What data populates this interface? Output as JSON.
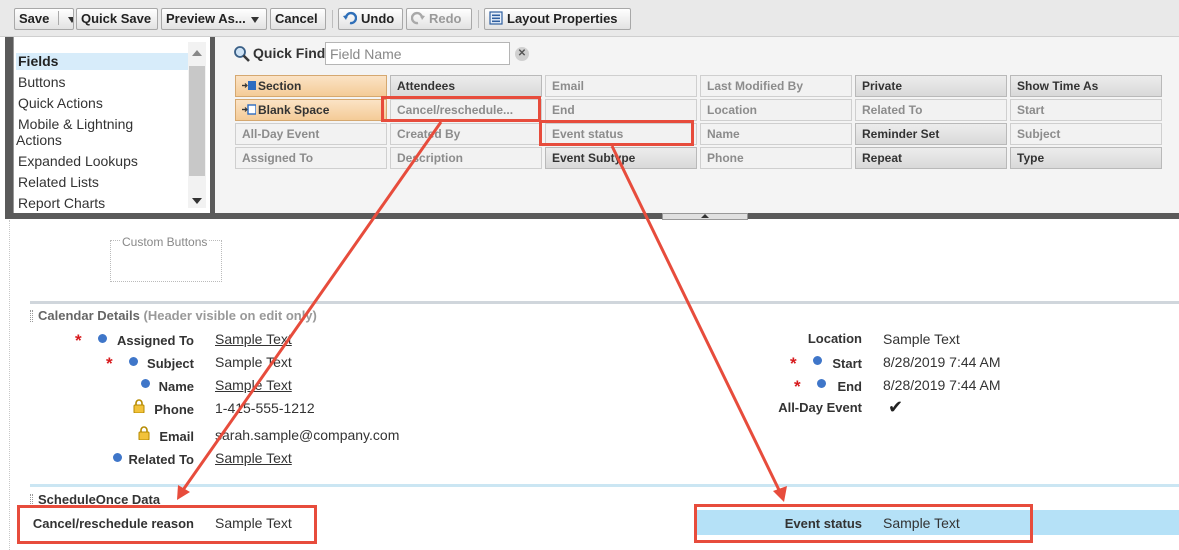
{
  "toolbar": {
    "save_label": "Save",
    "quick_save_label": "Quick Save",
    "preview_label": "Preview As...",
    "cancel_label": "Cancel",
    "undo_label": "Undo",
    "redo_label": "Redo",
    "layout_properties_label": "Layout Properties"
  },
  "palette": {
    "categories": [
      {
        "label": "Fields",
        "active": true
      },
      {
        "label": "Buttons"
      },
      {
        "label": "Quick Actions"
      },
      {
        "label": "Mobile & Lightning"
      },
      {
        "label": "Actions"
      },
      {
        "label": "Expanded Lookups"
      },
      {
        "label": "Related Lists"
      },
      {
        "label": "Report Charts"
      }
    ],
    "quick_find_label": "Quick Find",
    "quick_find_placeholder": "Field Name",
    "tiles": [
      [
        "Section",
        "Attendees",
        "Email",
        "Last Modified By",
        "Private",
        "Show Time As"
      ],
      [
        "Blank Space",
        "Cancel/reschedule...",
        "End",
        "Location",
        "Related To",
        "Start"
      ],
      [
        "All-Day Event",
        "Created By",
        "Event status",
        "Name",
        "Reminder Set",
        "Subject"
      ],
      [
        "Assigned To",
        "Description",
        "Event Subtype",
        "Phone",
        "Repeat",
        "Type"
      ]
    ]
  },
  "layout": {
    "custom_buttons_label": "Custom Buttons",
    "calendar_section": {
      "title": "Calendar Details",
      "subtitle": "(Header visible on edit only)",
      "left_fields": [
        {
          "label": "Assigned To",
          "value": "Sample Text"
        },
        {
          "label": "Subject",
          "value": "Sample Text"
        },
        {
          "label": "Name",
          "value": "Sample Text"
        },
        {
          "label": "Phone",
          "value": "1-415-555-1212"
        },
        {
          "label": "Email",
          "value": "sarah.sample@company.com"
        },
        {
          "label": "Related To",
          "value": "Sample Text"
        }
      ],
      "right_fields": [
        {
          "label": "Location",
          "value": "Sample Text"
        },
        {
          "label": "Start",
          "value": "8/28/2019 7:44 AM"
        },
        {
          "label": "End",
          "value": "8/28/2019 7:44 AM"
        },
        {
          "label": "All-Day Event",
          "value": "✔"
        }
      ]
    },
    "schedule_section": {
      "title": "ScheduleOnce Data",
      "fields": [
        {
          "label": "Cancel/reschedule reason",
          "value": "Sample Text"
        },
        {
          "label": "Event status",
          "value": "Sample Text"
        }
      ]
    }
  },
  "colors": {
    "annotation_red": "#e74c3c",
    "highlight_blue": "#b5e1f7",
    "required_red": "#d7191c",
    "info_dot_blue": "#3f76c9",
    "special_tile_orange": "#f4cb97"
  }
}
